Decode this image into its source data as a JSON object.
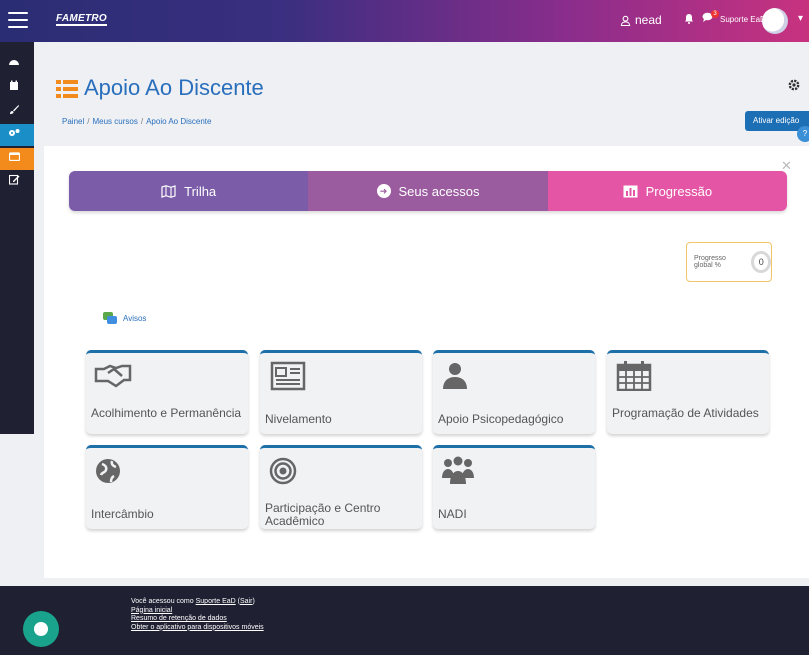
{
  "navbar": {
    "logo": "FAMETRO",
    "user_label": "nead",
    "notification_count": "3",
    "support_user": "Suporte EaD"
  },
  "sidebar": {
    "items": [
      "dashboard-icon",
      "calendar-icon",
      "brush-icon",
      "settings-icon",
      "folder-icon",
      "edit-icon"
    ]
  },
  "header": {
    "title": "Apoio Ao Discente",
    "breadcrumb": [
      "Painel",
      "Meus cursos",
      "Apoio Ao Discente"
    ],
    "edit_button": "Ativar edição"
  },
  "tabs": [
    {
      "label": "Trilha",
      "icon": "map-icon"
    },
    {
      "label": "Seus acessos",
      "icon": "sign-in-icon"
    },
    {
      "label": "Progressão",
      "icon": "bar-chart-icon"
    }
  ],
  "progress": {
    "label": "Progresso global %",
    "value": "0"
  },
  "avisos": {
    "label": "Avisos"
  },
  "tiles": [
    {
      "label": "Acolhimento e Permanência",
      "icon": "handshake-icon"
    },
    {
      "label": "Nivelamento",
      "icon": "newspaper-icon"
    },
    {
      "label": "Apoio Psicopedagógico",
      "icon": "user-icon"
    },
    {
      "label": "Programação de Atividades",
      "icon": "calendar-icon"
    },
    {
      "label": "Intercâmbio",
      "icon": "globe-icon"
    },
    {
      "label": "Participação e Centro Acadêmico",
      "icon": "target-icon"
    },
    {
      "label": "NADI",
      "icon": "users-icon"
    }
  ],
  "footer": {
    "logged_prefix": "Você acessou como",
    "logged_user": "Suporte EaD",
    "logout": "Sair",
    "home": "Página inicial",
    "data_retention": "Resumo de retenção de dados",
    "mobile_app": "Obter o aplicativo para dispositivos móveis"
  },
  "colors": {
    "accent": "#2a6fbd",
    "tile_border": "#1d6fa8",
    "tab_trilha": "#7a5ca8",
    "tab_acessos": "#9a5c9f",
    "tab_progressao": "#e555a5",
    "sidebar_bg": "#1f2133",
    "chat_fab": "#1aa38c"
  }
}
